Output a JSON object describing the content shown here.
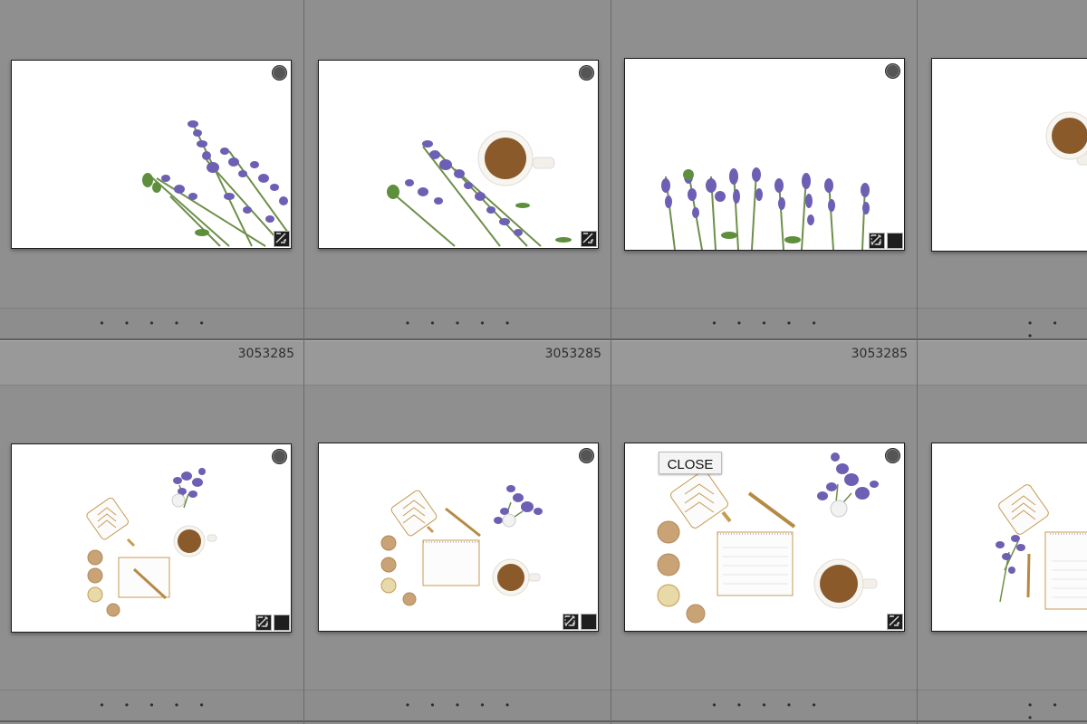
{
  "grid": {
    "cells": [
      {
        "row": 0,
        "col": 0,
        "image": "lavender-bouquet-corner",
        "header_number": "",
        "footer_dots": "• • • • •",
        "has_circle_badge": true,
        "badge_icons": [
          "develop-adjusted-icon"
        ]
      },
      {
        "row": 0,
        "col": 1,
        "image": "lavender-and-coffee",
        "header_number": "",
        "footer_dots": "• • • • •",
        "has_circle_badge": true,
        "badge_icons": [
          "develop-adjusted-icon"
        ]
      },
      {
        "row": 0,
        "col": 2,
        "image": "lavender-row",
        "header_number": "",
        "footer_dots": "• • • • •",
        "has_circle_badge": true,
        "badge_icons": [
          "crop-icon",
          "develop-adjusted-icon"
        ]
      },
      {
        "row": 0,
        "col": 3,
        "image": "coffee-cup-partial",
        "header_number": "",
        "footer_dots": "• • •",
        "has_circle_badge": false,
        "badge_icons": []
      },
      {
        "row": 1,
        "col": 0,
        "image": "desk-flatlay-small",
        "header_number": "3053285",
        "footer_dots": "• • • • •",
        "has_circle_badge": true,
        "badge_icons": [
          "crop-icon",
          "develop-adjusted-icon"
        ]
      },
      {
        "row": 1,
        "col": 1,
        "image": "desk-flatlay-medium",
        "header_number": "3053285",
        "footer_dots": "• • • • •",
        "has_circle_badge": true,
        "badge_icons": [
          "crop-icon",
          "develop-adjusted-icon"
        ]
      },
      {
        "row": 1,
        "col": 2,
        "image": "desk-flatlay-large",
        "header_number": "3053285",
        "footer_dots": "• • • • •",
        "has_circle_badge": true,
        "badge_icons": [
          "develop-adjusted-icon"
        ]
      },
      {
        "row": 1,
        "col": 3,
        "image": "desk-flatlay-notes-partial",
        "header_number": "",
        "footer_dots": "• • •",
        "has_circle_badge": false,
        "badge_icons": []
      }
    ]
  },
  "close_button": {
    "label": "CLOSE"
  },
  "colors": {
    "grid_background": "#8f8f8f",
    "header_background": "#999999",
    "lavender": "#6c5fb4",
    "stem": "#6e8f4a",
    "coffee": "#8a5a2b",
    "gold": "#c79b52"
  }
}
